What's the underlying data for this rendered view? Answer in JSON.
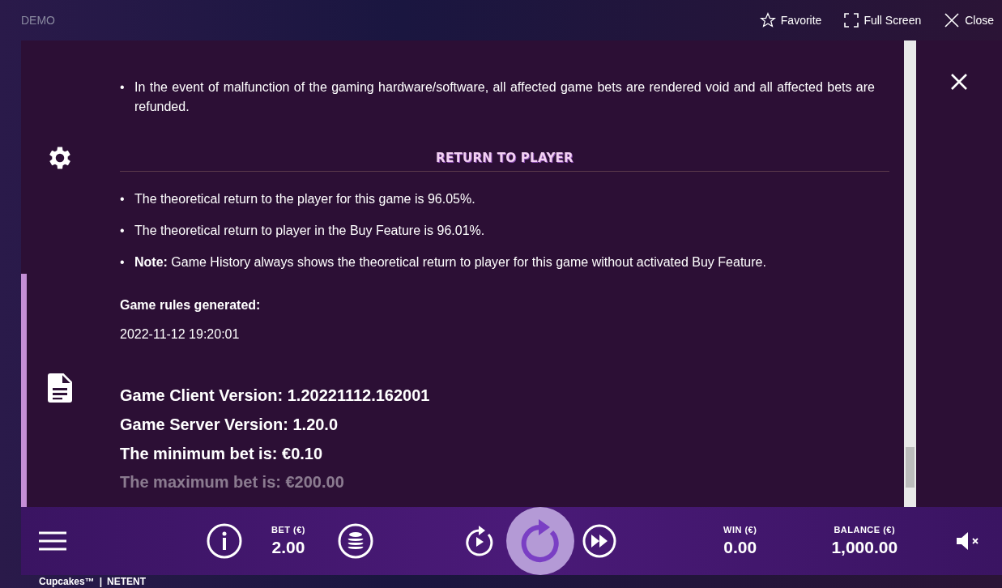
{
  "top_bar": {
    "label": "DEMO",
    "actions": [
      {
        "kind": "favorite",
        "label": "Favorite"
      },
      {
        "kind": "fullscreen",
        "label": "Full Screen"
      },
      {
        "kind": "close",
        "label": "Close"
      }
    ]
  },
  "rules": {
    "intro_bullets": [
      {
        "marker": "•",
        "text": "In the event of malfunction of the gaming hardware/software, all affected game bets are rendered void and all affected bets are refunded."
      }
    ],
    "heading": "RETURN TO PLAYER",
    "bullets": [
      {
        "marker": "•",
        "text": "The theoretical return to the player for this game is 96.05%."
      },
      {
        "marker": "•",
        "text": "The theoretical return to player in the Buy Feature is 96.01%."
      },
      {
        "marker": "•",
        "text": "**Note:** Game History always shows the theoretical return to player for this game without activated Buy Feature."
      }
    ],
    "generated_label": "Game rules generated:",
    "generated_value": "2022-11-12 19:20:01",
    "versions": [
      "Game Client Version: 1.20221112.162001",
      "Game Server Version: 1.20.0",
      "The minimum bet is: €0.10",
      "The maximum bet is: €200.00"
    ]
  },
  "control_bar": {
    "bet_label": "BET (€)",
    "bet_value": "2.00",
    "win_label": "WIN (€)",
    "win_value": "0.00",
    "balance_label": "BALANCE (€)",
    "balance_value": "1,000.00",
    "muted": true
  },
  "footer": {
    "game": "Cupcakes™",
    "separator": "|",
    "brand": "NETENT"
  }
}
